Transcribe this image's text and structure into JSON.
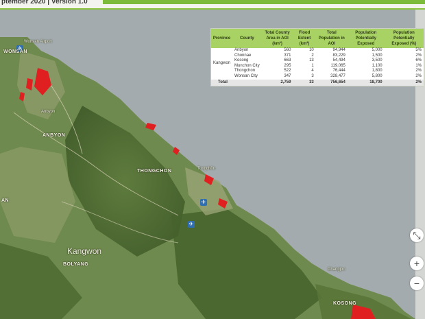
{
  "header": {
    "title": "ptember 2020 | Version 1.0",
    "accent_color": "#7cbb3a"
  },
  "map": {
    "labels": {
      "wonsan": "WONSAN",
      "wonsan_airport": "Wonsan Airport",
      "anbyon": "Anbyon",
      "anbyon_caps": "ANBYON",
      "thongchon_caps": "THONGCHON",
      "thongchon": "Tongchŏn",
      "kangwon": "Kangwon",
      "bolyang": "BOLYANG",
      "changjon": "Changjon",
      "kosong": "KOSONG",
      "an": "AN"
    },
    "icons": [
      "airport-icon",
      "airport-icon",
      "airport-icon"
    ],
    "flood_color": "#e02020"
  },
  "table": {
    "headers": {
      "province": "Province",
      "county": "County",
      "area": "Total County Area in AOI (km²)",
      "flood": "Flood Extent (km²)",
      "population": "Total Population in AOI",
      "exposed": "Population Potentially Exposed",
      "exposed_pct": "Population Potentially Exposed (%)"
    },
    "province": "Kangwon",
    "rows": [
      {
        "county": "Anbyon",
        "area": "560",
        "flood": "10",
        "population": "94,944",
        "exposed": "5,000",
        "pct": "5%"
      },
      {
        "county": "Chonnae",
        "area": "371",
        "flood": "2",
        "population": "83,229",
        "exposed": "1,500",
        "pct": "2%"
      },
      {
        "county": "Kosong",
        "area": "663",
        "flood": "13",
        "population": "54,494",
        "exposed": "3,500",
        "pct": "6%"
      },
      {
        "county": "Munchon City",
        "area": "295",
        "flood": "1",
        "population": "119,065",
        "exposed": "1,100",
        "pct": "1%"
      },
      {
        "county": "Thongchon",
        "area": "522",
        "flood": "4",
        "population": "76,444",
        "exposed": "1,800",
        "pct": "2%"
      },
      {
        "county": "Wonsan City",
        "area": "347",
        "flood": "3",
        "population": "328,477",
        "exposed": "5,800",
        "pct": "2%"
      }
    ],
    "total": {
      "label": "Total",
      "area": "2,759",
      "flood": "33",
      "population": "756,654",
      "exposed": "18,700",
      "pct": "2%"
    },
    "header_color": "#a9d264"
  },
  "controls": {
    "collapse": "⤡",
    "zoom_in": "+",
    "zoom_out": "−"
  }
}
